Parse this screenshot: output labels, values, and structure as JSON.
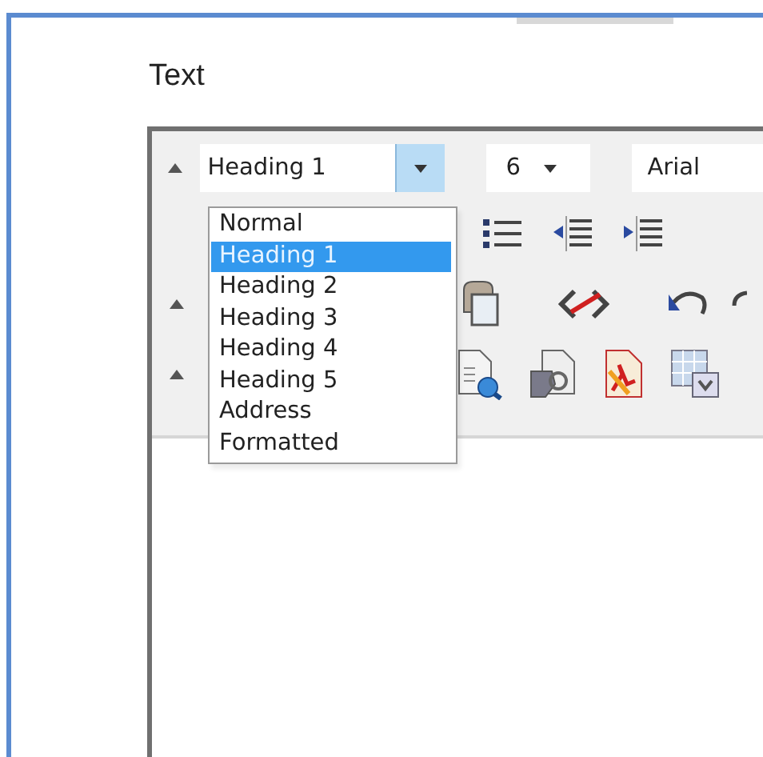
{
  "section_label": "Text",
  "editor": {
    "style_combo": {
      "value": "Heading 1",
      "expanded": true
    },
    "size_combo": {
      "value": "6"
    },
    "font_combo": {
      "value": "Arial"
    },
    "style_menu": [
      {
        "label": "Normal",
        "selected": false
      },
      {
        "label": "Heading 1",
        "selected": true
      },
      {
        "label": "Heading 2",
        "selected": false
      },
      {
        "label": "Heading 3",
        "selected": false
      },
      {
        "label": "Heading 4",
        "selected": false
      },
      {
        "label": "Heading 5",
        "selected": false
      },
      {
        "label": "Address",
        "selected": false
      },
      {
        "label": "Formatted",
        "selected": false
      }
    ]
  }
}
